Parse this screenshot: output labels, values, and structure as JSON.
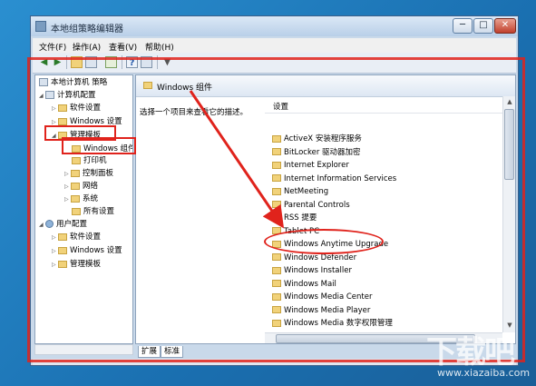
{
  "window": {
    "title": "本地组策略编辑器",
    "min_glyph": "─",
    "max_glyph": "□",
    "close_glyph": "✕"
  },
  "menu": [
    "文件(F)",
    "操作(A)",
    "查看(V)",
    "帮助(H)"
  ],
  "toolbar": {
    "icons": [
      "back-arrow-icon",
      "forward-arrow-icon",
      "up-folder-icon",
      "show-hide-tree-icon",
      "export-list-icon",
      "help-icon",
      "properties-icon",
      "filter-icon"
    ]
  },
  "tree": {
    "root": "本地计算机 策略",
    "computer_config": "计算机配置",
    "software_settings": "软件设置",
    "windows_settings": "Windows 设置",
    "admin_templates": "管理模板",
    "windows_components": "Windows 组件",
    "printers": "打印机",
    "control_panel": "控制面板",
    "network": "网络",
    "system": "系统",
    "all_settings": "所有设置",
    "user_config": "用户配置",
    "user_software_settings": "软件设置",
    "user_windows_settings": "Windows 设置",
    "user_admin_templates": "管理模板"
  },
  "right_pane": {
    "header": "Windows 组件",
    "description": "选择一个项目来查看它的描述。",
    "column_header": "设置",
    "items": [
      "ActiveX 安装程序服务",
      "BitLocker 驱动器加密",
      "Internet Explorer",
      "Internet Information Services",
      "NetMeeting",
      "Parental Controls",
      "RSS 提要",
      "Tablet PC",
      "Windows Anytime Upgrade",
      "Windows Defender",
      "Windows Installer",
      "Windows Mail",
      "Windows Media Center",
      "Windows Media Player",
      "Windows Media 数字权限管理"
    ]
  },
  "tabs": [
    "扩展",
    "标准"
  ],
  "colors": {
    "annotation_red": "#e0231c",
    "desktop_blue": "#1e7fc0"
  }
}
